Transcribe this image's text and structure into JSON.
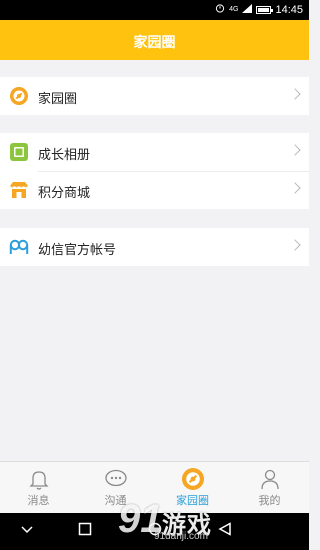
{
  "status_bar": {
    "time": "14:45",
    "network": "4G"
  },
  "header": {
    "title": "家园圈"
  },
  "groups": [
    {
      "items": [
        {
          "label": "家园圈",
          "icon": "circle-orange-icon"
        }
      ]
    },
    {
      "items": [
        {
          "label": "成长相册",
          "icon": "album-icon"
        },
        {
          "label": "积分商城",
          "icon": "shop-icon"
        }
      ]
    },
    {
      "items": [
        {
          "label": "幼信官方帐号",
          "icon": "official-account-icon"
        }
      ]
    }
  ],
  "tabs": [
    {
      "label": "消息",
      "icon": "bell-icon",
      "active": false
    },
    {
      "label": "沟通",
      "icon": "chat-icon",
      "active": false
    },
    {
      "label": "家园圈",
      "icon": "circle-orange-icon",
      "active": true
    },
    {
      "label": "我的",
      "icon": "person-icon",
      "active": false
    }
  ],
  "watermark": {
    "brand": "91",
    "text": "游戏",
    "url": "91danji.com"
  },
  "colors": {
    "accent": "#ffc20e",
    "active_tab": "#2b9fda",
    "icon_orange": "#f5a623",
    "icon_green": "#8cc63f",
    "icon_blue": "#2b9fda"
  }
}
